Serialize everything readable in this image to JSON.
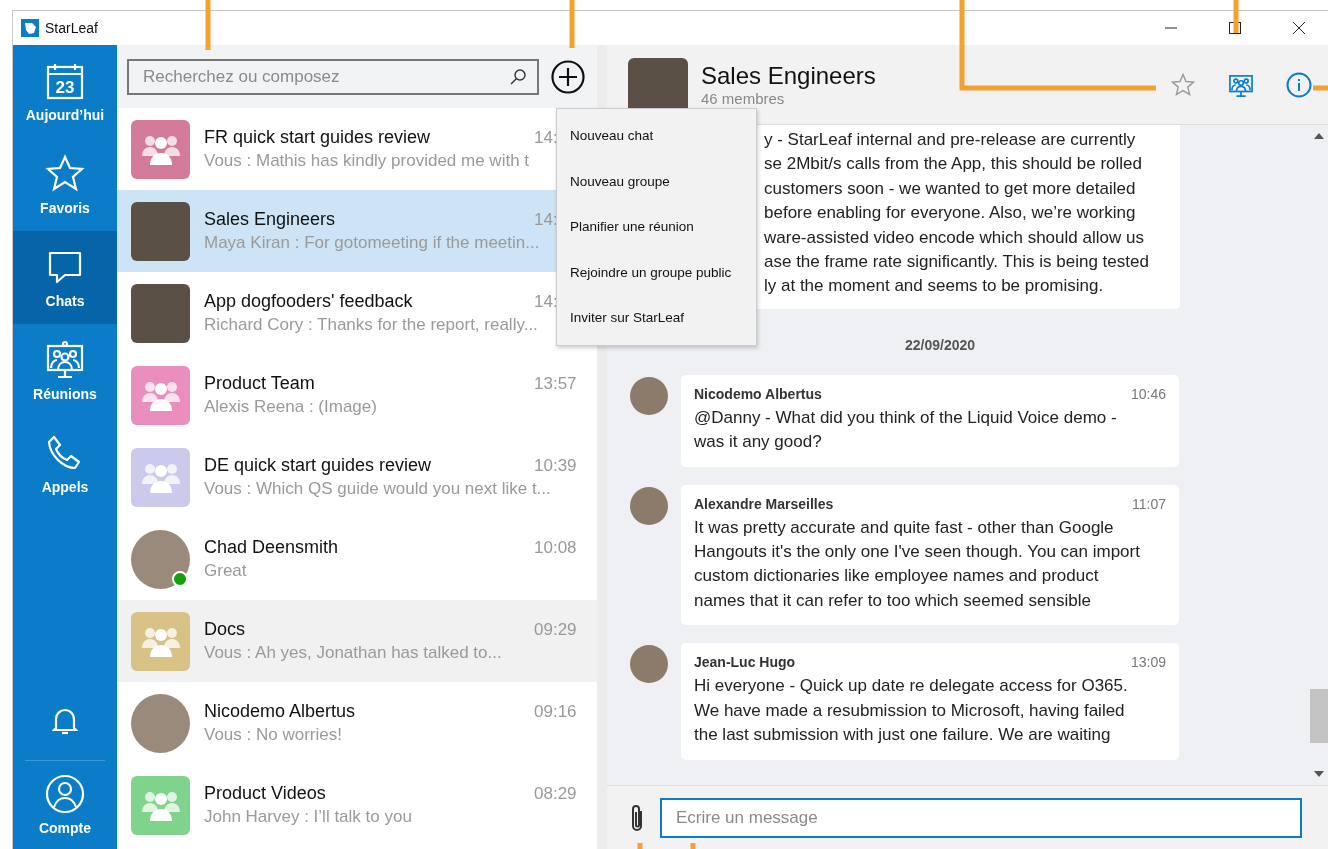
{
  "window": {
    "title": "StarLeaf"
  },
  "nav": {
    "items": [
      {
        "kind": "calendar",
        "label": "Aujourd’hui",
        "day": "23",
        "selected": false
      },
      {
        "kind": "star",
        "label": "Favoris",
        "selected": false
      },
      {
        "kind": "chat",
        "label": "Chats",
        "selected": true
      },
      {
        "kind": "meeting",
        "label": "Réunions",
        "selected": false
      },
      {
        "kind": "phone",
        "label": "Appels",
        "selected": false
      }
    ],
    "account": {
      "label": "Compte"
    }
  },
  "search": {
    "placeholder": "Recherchez ou composez"
  },
  "chats": [
    {
      "name": "FR quick start guides review",
      "time": "14:",
      "preview": "Vous : Mathis has kindly provided me with t",
      "avatar": {
        "kind": "group",
        "color": "#d47a9a"
      },
      "selected": false,
      "hovered": false,
      "online": false
    },
    {
      "name": "Sales Engineers",
      "time": "14:",
      "preview": "Maya Kiran : For gotomeeting if the meetin...",
      "avatar": {
        "kind": "photo"
      },
      "selected": true,
      "hovered": false,
      "online": false
    },
    {
      "name": "App dogfooders' feedback",
      "time": "14:",
      "preview": "Richard Cory : Thanks for the report, really...",
      "avatar": {
        "kind": "photo"
      },
      "selected": false,
      "hovered": false,
      "online": false
    },
    {
      "name": "Product Team",
      "time": "13:57",
      "preview": "Alexis Reena :  (Image)",
      "avatar": {
        "kind": "group",
        "color": "#ea8ebd"
      },
      "selected": false,
      "hovered": false,
      "online": false
    },
    {
      "name": "DE quick start guides review",
      "time": "10:39",
      "preview": "Vous : Which QS guide would you next like t...",
      "avatar": {
        "kind": "group",
        "color": "#cbc9ec"
      },
      "selected": false,
      "hovered": false,
      "online": false
    },
    {
      "name": "Chad Deensmith",
      "time": "10:08",
      "preview": "Great",
      "avatar": {
        "kind": "person"
      },
      "selected": false,
      "hovered": false,
      "online": true
    },
    {
      "name": "Docs",
      "time": "09:29",
      "preview": "Vous : Ah yes, Jonathan has talked to...",
      "avatar": {
        "kind": "group",
        "color": "#d8c286"
      },
      "selected": false,
      "hovered": true,
      "online": false
    },
    {
      "name": "Nicodemo Albertus",
      "time": "09:16",
      "preview": "Vous : No worries!",
      "avatar": {
        "kind": "person"
      },
      "selected": false,
      "hovered": false,
      "online": false
    },
    {
      "name": "Product Videos",
      "time": "08:29",
      "preview": "John Harvey : I’ll talk to you",
      "avatar": {
        "kind": "group",
        "color": "#7fd38a"
      },
      "selected": false,
      "hovered": false,
      "online": false
    }
  ],
  "new_menu": {
    "items": [
      "Nouveau chat",
      "Nouveau groupe",
      "Planifier une réunion",
      "Rejoindre un groupe public",
      "Inviter sur StarLeaf"
    ]
  },
  "conversation": {
    "title": "Sales Engineers",
    "subtitle": "46 membres",
    "messages": [
      {
        "kind": "partial",
        "lines": [
          "y - StarLeaf internal and pre-release are currently",
          "se 2Mbit/s calls from the App, this should be rolled",
          "customers soon - we wanted to get more detailed",
          "before enabling for everyone. Also, we’re working",
          "ware-assisted video encode which should allow us",
          "ase the frame rate significantly. This is being tested",
          "ly at the moment and seems to be promising."
        ]
      },
      {
        "kind": "date",
        "text": "22/09/2020"
      },
      {
        "kind": "message",
        "author": "Nicodemo Albertus",
        "time": "10:46",
        "text": "@Danny - What did you think of the Liquid Voice demo - was it any good?"
      },
      {
        "kind": "message",
        "author": "Alexandre Marseilles",
        "time": "11:07",
        "text": "It was pretty accurate and quite fast - other than Google Hangouts it's the only one I've seen though. You can import custom dictionaries like employee names and product names that it can refer to too which seemed sensible"
      },
      {
        "kind": "message",
        "author": "Jean-Luc Hugo",
        "time": "13:09",
        "text": "Hi everyone - Quick up date re delegate access for O365. We have made a resubmission to Microsoft, having failed the last submission with just one failure.  We are waiting"
      }
    ]
  },
  "composer": {
    "placeholder": "Ecrire un message"
  }
}
